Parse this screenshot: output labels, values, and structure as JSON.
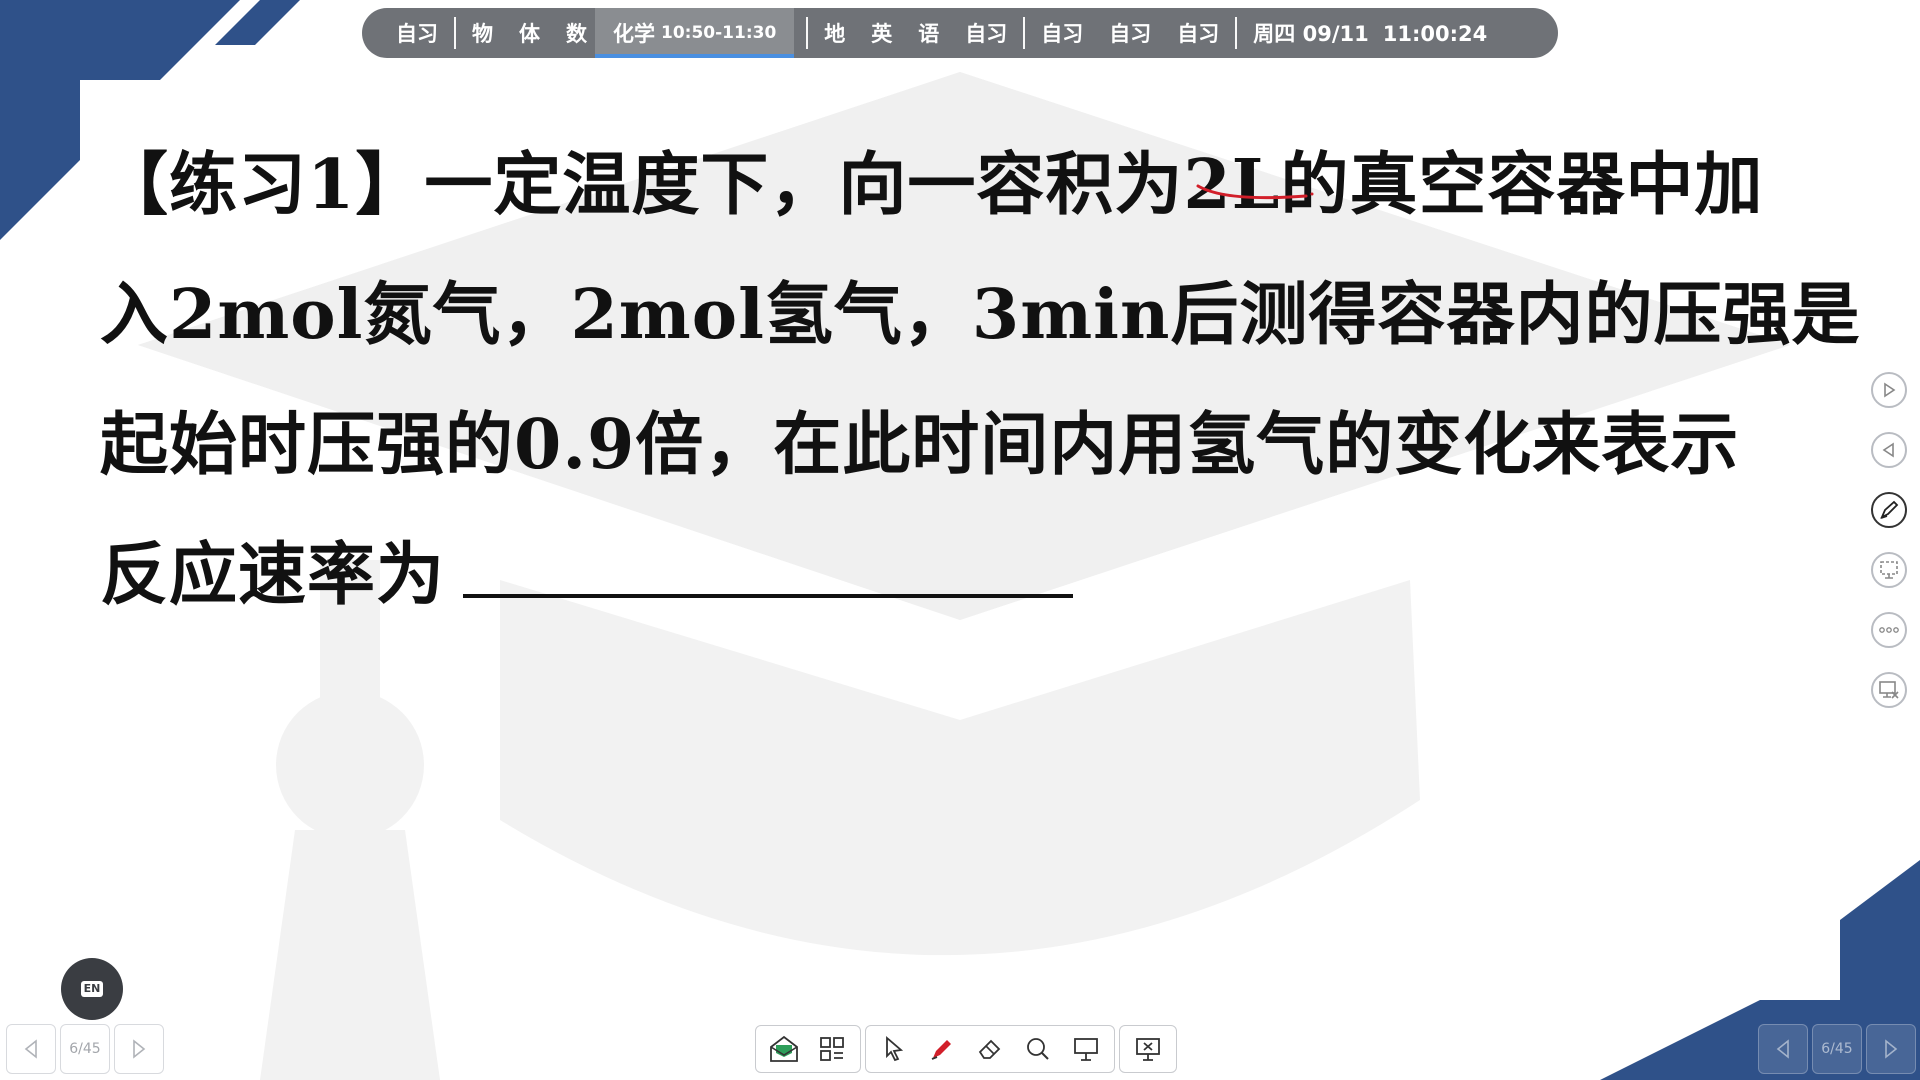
{
  "schedule": {
    "slot1": "自习",
    "group2": [
      "物",
      "体",
      "数"
    ],
    "current_subject": "化学",
    "current_time": "10:50-11:30",
    "group3": [
      "地",
      "英",
      "语",
      "自习"
    ],
    "group4": [
      "自习",
      "自习",
      "自习"
    ],
    "weekday_date": "周四 09/11",
    "clock": "11:00:24"
  },
  "question": {
    "line1": "【练习1】一定温度下，向一容积为2L的真空容器中加",
    "line2": "入2mol氮气，2mol氢气，3min后测得容器内的压强是",
    "line3": "起始时压强的0.9倍，在此时间内用氢气的变化来表示",
    "line4": "反应速率为"
  },
  "side_tools": [
    "play-icon",
    "prev-icon",
    "pen-icon",
    "screen-select-icon",
    "more-icon",
    "close-screen-icon"
  ],
  "toolbar": [
    "message-icon",
    "apps-grid-icon",
    "pointer-icon",
    "pen-icon",
    "eraser-icon",
    "zoom-icon",
    "whiteboard-icon",
    "close-screen-icon"
  ],
  "pager": {
    "left": "6/45",
    "right": "6/45"
  },
  "en_label": "EN",
  "colors": {
    "brand_blue": "#2f5189",
    "bar_gray": "#6f7277",
    "accent_blue": "#4a8fe0",
    "annotation_red": "#d21f2a"
  }
}
